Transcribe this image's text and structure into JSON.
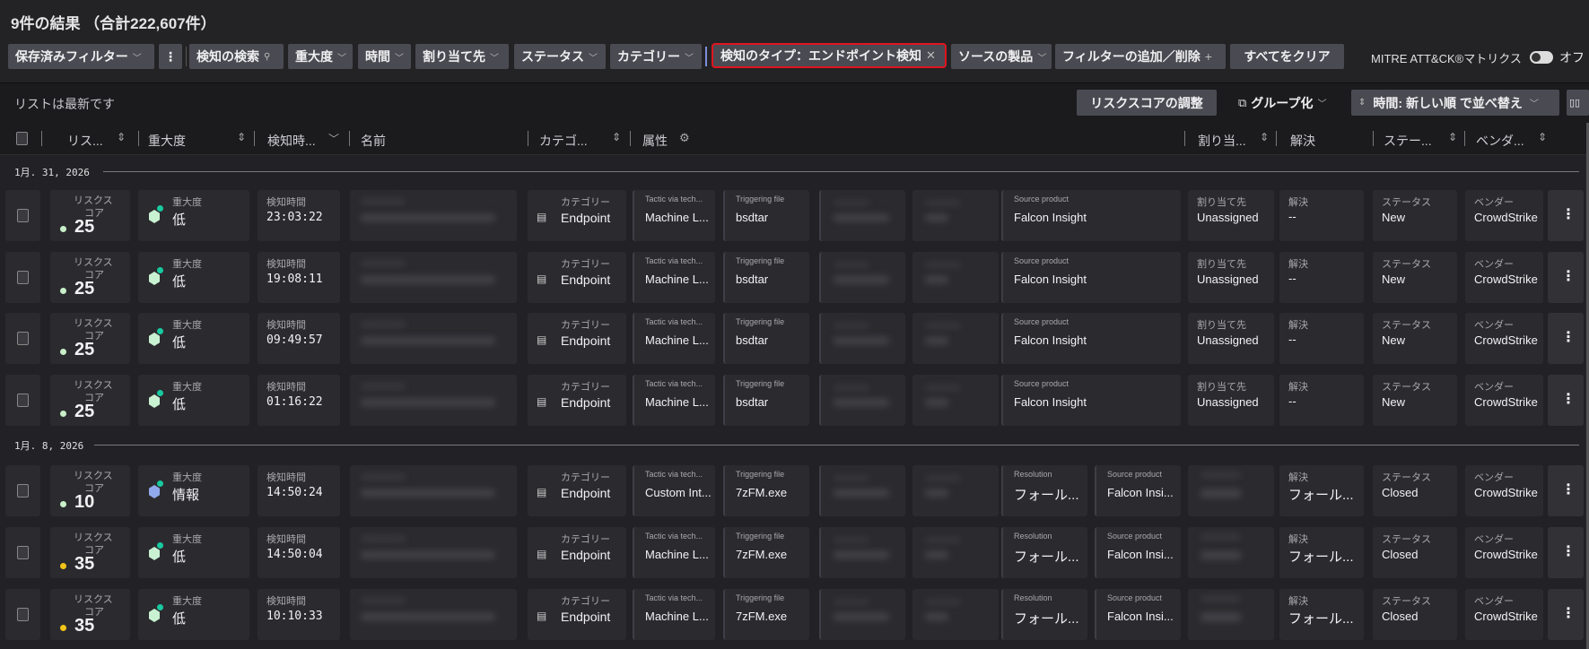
{
  "header": {
    "title": "9件の結果 （合計222,607件）"
  },
  "toolbar": {
    "saved_filters": "保存済みフィルター",
    "search": "検知の検索",
    "severity": "重大度",
    "time": "時間",
    "assignee": "割り当て先",
    "status": "ステータス",
    "category": "カテゴリー",
    "active_filter": "検知のタイプ：エンドポイント検知",
    "source_product": "ソースの製品",
    "add_remove_filter": "フィルターの追加／削除",
    "clear_all": "すべてをクリア",
    "mitre_label": "MITRE ATT&CK®マトリクス",
    "mitre_state": "オフ",
    "active_filter_border": "#e0141e"
  },
  "subbar": {
    "list_status": "リストは最新です",
    "adjust_risk": "リスクスコアの調整",
    "group_by": "グループ化",
    "sort": "時間: 新しい順 で並べ替え"
  },
  "columns": {
    "risk": "リス...",
    "severity": "重大度",
    "time": "検知時...",
    "name": "名前",
    "category": "カテゴ...",
    "attributes": "属性",
    "assignee": "割り当...",
    "resolution": "解決",
    "status": "ステー...",
    "vendor": "ベンダ..."
  },
  "labels": {
    "risk": "リスクス",
    "risk2": "コア",
    "severity": "重大度",
    "time": "検知時間",
    "category": "カテゴリー",
    "tactic": "Tactic via tech...",
    "trigger": "Triggering file",
    "source": "Source product",
    "assignee": "割り当て先",
    "resolution_en": "Resolution",
    "resolution": "解決",
    "status": "ステータス",
    "vendor": "ベンダー"
  },
  "groups": [
    {
      "date": "1月. 31, 2026",
      "rows": [
        {
          "risk": "25",
          "risk_color": "#c8efc8",
          "severity": "低",
          "sev_color": "#c9f2d2",
          "time": "23:03:22",
          "category": "Endpoint",
          "tactic": "Machine L...",
          "trigger": "bsdtar",
          "source": "Falcon Insight",
          "assignee": "Unassigned",
          "resolution": "--",
          "status": "New",
          "vendor": "CrowdStrike"
        },
        {
          "risk": "25",
          "risk_color": "#c8efc8",
          "severity": "低",
          "sev_color": "#c9f2d2",
          "time": "19:08:11",
          "category": "Endpoint",
          "tactic": "Machine L...",
          "trigger": "bsdtar",
          "source": "Falcon Insight",
          "assignee": "Unassigned",
          "resolution": "--",
          "status": "New",
          "vendor": "CrowdStrike"
        },
        {
          "risk": "25",
          "risk_color": "#c8efc8",
          "severity": "低",
          "sev_color": "#c9f2d2",
          "time": "09:49:57",
          "category": "Endpoint",
          "tactic": "Machine L...",
          "trigger": "bsdtar",
          "source": "Falcon Insight",
          "assignee": "Unassigned",
          "resolution": "--",
          "status": "New",
          "vendor": "CrowdStrike"
        },
        {
          "risk": "25",
          "risk_color": "#c8efc8",
          "severity": "低",
          "sev_color": "#c9f2d2",
          "time": "01:16:22",
          "category": "Endpoint",
          "tactic": "Machine L...",
          "trigger": "bsdtar",
          "source": "Falcon Insight",
          "assignee": "Unassigned",
          "resolution": "--",
          "status": "New",
          "vendor": "CrowdStrike"
        }
      ]
    },
    {
      "date": "1月. 8, 2026",
      "rows": [
        {
          "risk": "10",
          "risk_color": "#c8efc8",
          "severity": "情報",
          "sev_color": "#8fa9ec",
          "time": "14:50:24",
          "category": "Endpoint",
          "tactic": "Custom Int...",
          "trigger": "7zFM.exe",
          "resolution_attr": "フォール...",
          "source": "Falcon Insi...",
          "resolution": "フォール...",
          "status": "Closed",
          "vendor": "CrowdStrike"
        },
        {
          "risk": "35",
          "risk_color": "#f2c418",
          "severity": "低",
          "sev_color": "#c9f2d2",
          "time": "14:50:04",
          "category": "Endpoint",
          "tactic": "Machine L...",
          "trigger": "7zFM.exe",
          "resolution_attr": "フォール...",
          "source": "Falcon Insi...",
          "resolution": "フォール...",
          "status": "Closed",
          "vendor": "CrowdStrike"
        },
        {
          "risk": "35",
          "risk_color": "#f2c418",
          "severity": "低",
          "sev_color": "#c9f2d2",
          "time": "10:10:33",
          "category": "Endpoint",
          "tactic": "Machine L...",
          "trigger": "7zFM.exe",
          "resolution_attr": "フォール...",
          "source": "Falcon Insi...",
          "resolution": "フォール...",
          "status": "Closed",
          "vendor": "CrowdStrike"
        }
      ]
    }
  ]
}
